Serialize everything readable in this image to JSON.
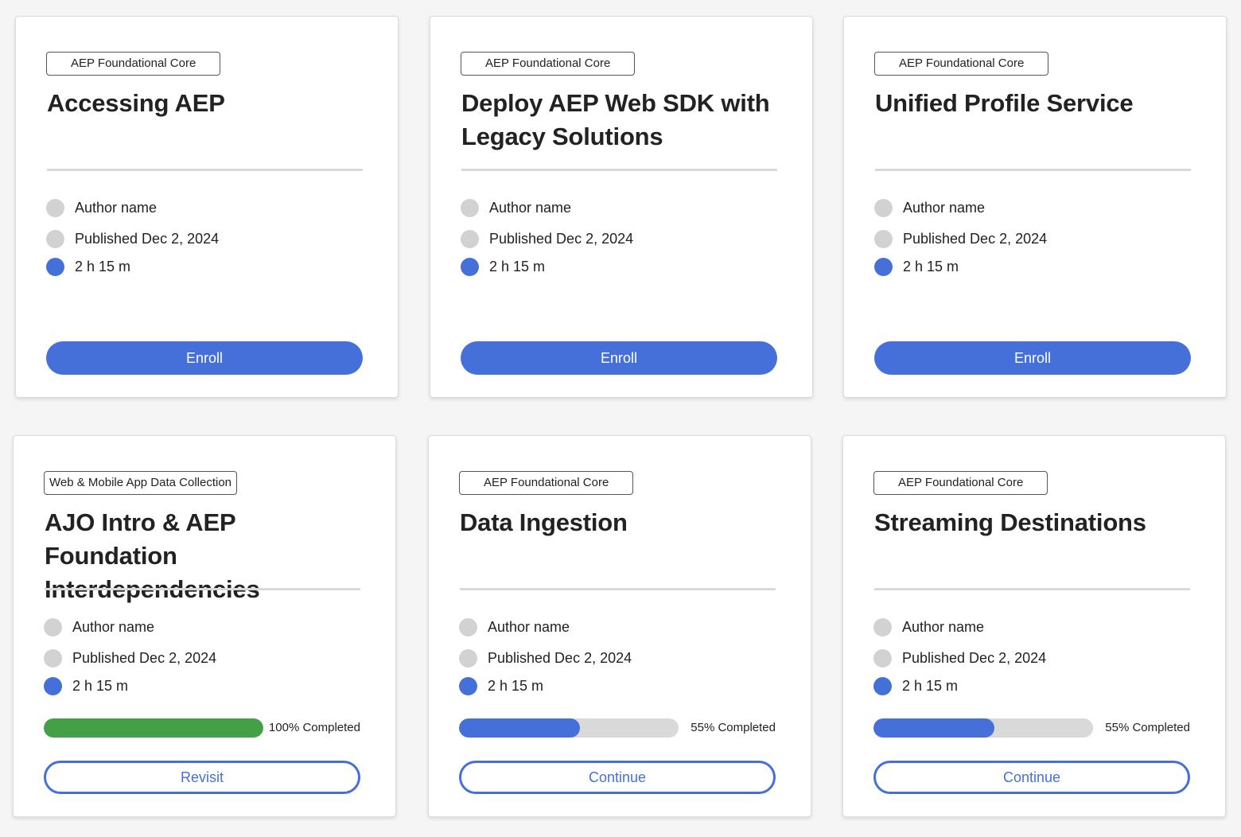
{
  "colors": {
    "accent": "#4570d9",
    "complete": "#44a047",
    "track": "#d9d9d9",
    "placeholder": "#d2d2d2"
  },
  "cards": [
    {
      "tag": "AEP Foundational Core",
      "title": "Accessing AEP",
      "author": "Author name",
      "published": "Published Dec 2, 2024",
      "duration": "2 h 15 m",
      "action": "Enroll"
    },
    {
      "tag": "AEP Foundational Core",
      "title": "Deploy AEP Web SDK with Legacy Solutions",
      "author": "Author name",
      "published": "Published Dec 2, 2024",
      "duration": "2 h 15 m",
      "action": "Enroll"
    },
    {
      "tag": "AEP Foundational Core",
      "title": "Unified Profile Service",
      "author": "Author name",
      "published": "Published Dec 2, 2024",
      "duration": "2 h 15 m",
      "action": "Enroll"
    },
    {
      "tag": "Web & Mobile App Data Collection",
      "title": "AJO Intro & AEP Foundation Interdependencies",
      "author": "Author name",
      "published": "Published Dec 2, 2024",
      "duration": "2 h 15 m",
      "progress": 100,
      "progress_label": "100% Completed",
      "action": "Revisit"
    },
    {
      "tag": "AEP Foundational Core",
      "title": "Data Ingestion",
      "author": "Author name",
      "published": "Published Dec 2, 2024",
      "duration": "2 h 15 m",
      "progress": 55,
      "progress_label": "55% Completed",
      "action": "Continue"
    },
    {
      "tag": "AEP Foundational Core",
      "title": "Streaming Destinations",
      "author": "Author name",
      "published": "Published Dec 2, 2024",
      "duration": "2 h 15 m",
      "progress": 55,
      "progress_label": "55% Completed",
      "action": "Continue"
    }
  ]
}
